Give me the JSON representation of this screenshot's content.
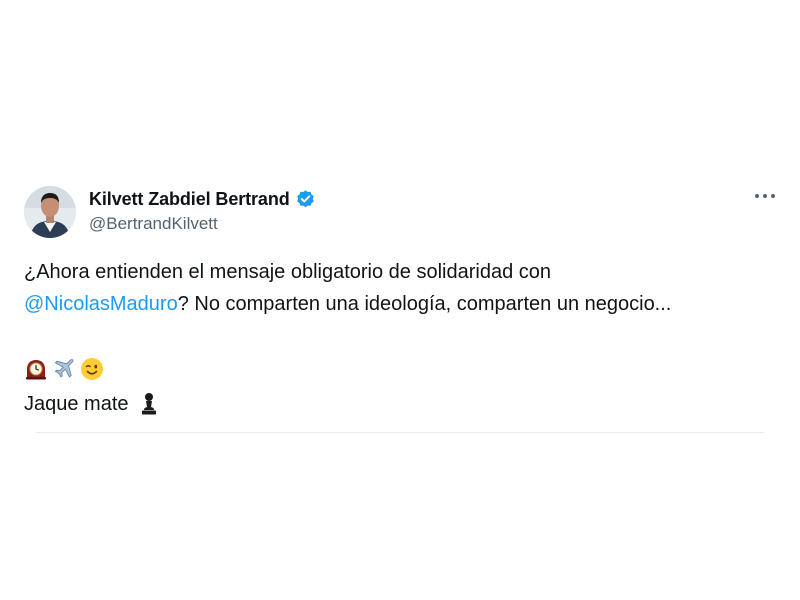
{
  "tweet": {
    "author": {
      "display_name": "Kilvett Zabdiel Bertrand",
      "handle": "@BertrandKilvett",
      "verified": true,
      "verified_color": "#1d9bf0"
    },
    "more_icon": "more-horizontal-icon",
    "text": {
      "line1": "¿Ahora entienden el mensaje obligatorio de solidaridad con",
      "mention": "@NicolasMaduro",
      "line2_rest": "?  No comparten una ideología, comparten un negocio..."
    },
    "emojis": [
      "mantelpiece-clock-icon",
      "airplane-icon",
      "winking-face-icon"
    ],
    "closing_text": "Jaque mate",
    "closing_emoji": "chess-pawn-icon",
    "mention_color": "#1d9bf0"
  }
}
